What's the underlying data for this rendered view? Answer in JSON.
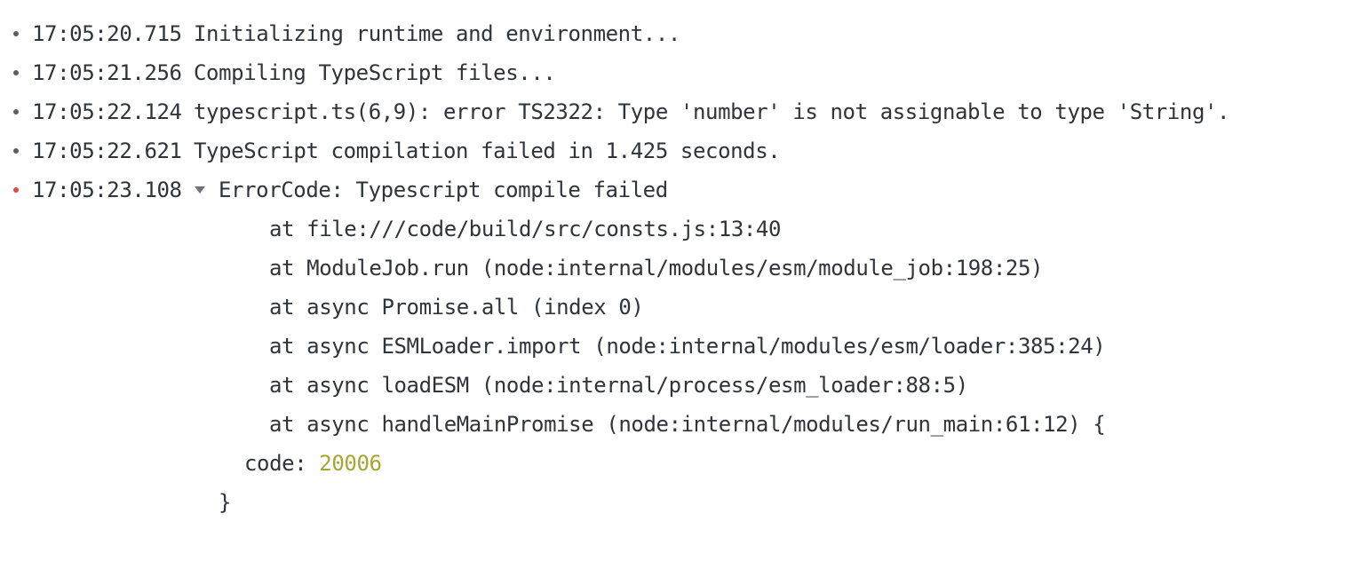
{
  "logs": [
    {
      "time": "17:05:20.715",
      "message": "Initializing runtime and environment...",
      "level": "info"
    },
    {
      "time": "17:05:21.256",
      "message": "Compiling TypeScript files...",
      "level": "info"
    },
    {
      "time": "17:05:22.124",
      "message": "typescript.ts(6,9): error TS2322: Type 'number' is not assignable to type 'String'.",
      "level": "info"
    },
    {
      "time": "17:05:22.621",
      "message": "TypeScript compilation failed in 1.425 seconds.",
      "level": "info"
    }
  ],
  "error_entry": {
    "time": "17:05:23.108",
    "message": "ErrorCode: Typescript compile failed",
    "level": "error",
    "stack": [
      "at file:///code/build/src/consts.js:13:40",
      "at ModuleJob.run (node:internal/modules/esm/module_job:198:25)",
      "at async Promise.all (index 0)",
      "at async ESMLoader.import (node:internal/modules/esm/loader:385:24)",
      "at async loadESM (node:internal/process/esm_loader:88:5)",
      "at async handleMainPromise (node:internal/modules/run_main:61:12) {"
    ],
    "prop_key": "code: ",
    "prop_value": "20006",
    "closing_brace": "}"
  },
  "colors": {
    "text": "#2f343b",
    "bullet": "#5b6068",
    "error_bullet": "#e5483f",
    "number": "#a9a530"
  }
}
